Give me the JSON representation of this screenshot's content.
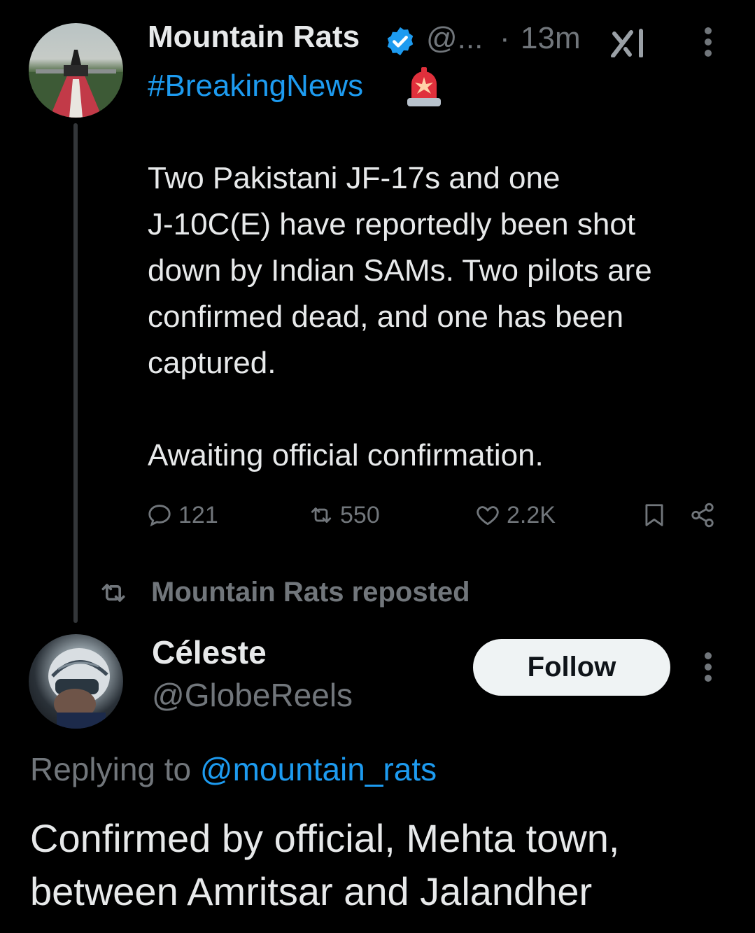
{
  "tweet1": {
    "author_name": "Mountain Rats",
    "handle": "@...",
    "separator": "·",
    "time": "13m",
    "avatar_icon": "statue-memorial-avatar",
    "verified_icon": "verified-badge-icon",
    "hashtag": "#BreakingNews",
    "hashtag_emoji_icon": "police-siren-icon",
    "body": "Two Pakistani JF-17s and one\nJ-10C(E) have reportedly been shot\ndown by Indian SAMs. Two pilots are\nconfirmed dead, and one has been\ncaptured.",
    "body2": "Awaiting official confirmation.",
    "stats": {
      "replies": "121",
      "reposts": "550",
      "likes": "2.2K"
    }
  },
  "repost_banner": {
    "text": "Mountain Rats reposted"
  },
  "tweet2": {
    "author_name": "Céleste",
    "handle": "@GlobeReels",
    "avatar_icon": "racing-helmet-avatar",
    "follow_label": "Follow",
    "replying_prefix": "Replying to ",
    "replying_handle": "@mountain_rats",
    "body": "Confirmed by official,  Mehta town,\nbetween Amritsar and Jalandher"
  },
  "colors": {
    "background": "#000000",
    "text_primary": "#e7e9ea",
    "text_secondary": "#71767b",
    "accent": "#1d9bf0",
    "follow_button_bg": "#eff3f4"
  }
}
